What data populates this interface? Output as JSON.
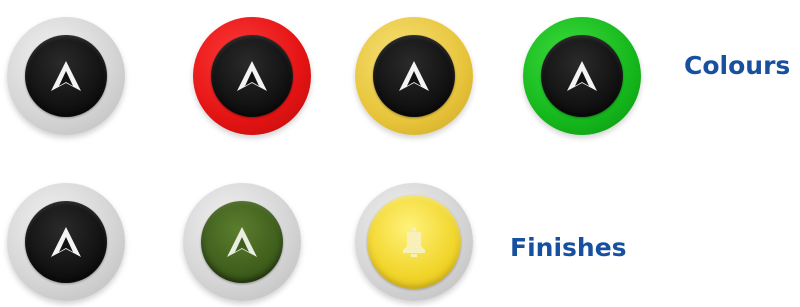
{
  "colours_row": {
    "label": "Colours",
    "buttons": [
      {
        "ring": "silver",
        "center": "black",
        "icon": "navigation-arrow-icon"
      },
      {
        "ring": "red",
        "center": "black",
        "icon": "navigation-arrow-icon"
      },
      {
        "ring": "yellow",
        "center": "black",
        "icon": "navigation-arrow-icon"
      },
      {
        "ring": "green",
        "center": "black",
        "icon": "navigation-arrow-icon"
      }
    ]
  },
  "finishes_row": {
    "label": "Finishes",
    "buttons": [
      {
        "ring": "silver",
        "center": "black",
        "icon": "navigation-arrow-icon"
      },
      {
        "ring": "silver",
        "center": "olive green",
        "icon": "navigation-arrow-icon"
      },
      {
        "ring": "silver",
        "center": "yellow",
        "icon": "bell-icon"
      }
    ]
  },
  "colors": {
    "label_text": "#16509e",
    "red": "#e41313",
    "yellow": "#e7c43a",
    "green": "#15b81c",
    "silver": "#d6d6d6",
    "black": "#121212",
    "olive": "#3f5f1c"
  }
}
